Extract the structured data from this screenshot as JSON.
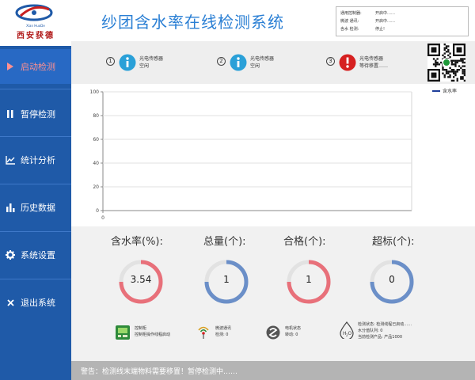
{
  "app": {
    "title": "纱团含水率在线检测系统",
    "logo_cn": "西安获德",
    "logo_en": "Xian HuoDe"
  },
  "status": {
    "rows": [
      {
        "key": "通用控制器:",
        "value": "开启中……"
      },
      {
        "key": "微波  通讯:",
        "value": "开启中……"
      },
      {
        "key": "含水  检测:",
        "value": "停止!"
      }
    ]
  },
  "sidebar": {
    "items": [
      {
        "label": "启动检测",
        "icon": "play-icon",
        "active": true
      },
      {
        "label": "暂停检测",
        "icon": "pause-icon",
        "active": false
      },
      {
        "label": "统计分析",
        "icon": "line-chart-icon",
        "active": false
      },
      {
        "label": "历史数据",
        "icon": "bar-chart-icon",
        "active": false
      },
      {
        "label": "系统设置",
        "icon": "gear-icon",
        "active": false
      },
      {
        "label": "退出系统",
        "icon": "close-icon",
        "active": false
      }
    ]
  },
  "sensors": [
    {
      "num": "1",
      "name": "光电传感器",
      "state": "空闲",
      "icon": "info-icon",
      "color": "#2aa0d8"
    },
    {
      "num": "2",
      "name": "光电传感器",
      "state": "空闲",
      "icon": "info-icon",
      "color": "#2aa0d8"
    },
    {
      "num": "3",
      "name": "光电传感器",
      "state": "等待移置……",
      "icon": "warning-icon",
      "color": "#d62020"
    }
  ],
  "chart_data": {
    "type": "line",
    "series": [
      {
        "name": "含水率",
        "values": []
      }
    ],
    "y_ticks": [
      "100",
      "80",
      "60",
      "40",
      "20",
      "0"
    ],
    "x_ticks": [
      "0"
    ],
    "ylim": [
      0,
      100
    ],
    "grid": true,
    "legend": "top-right"
  },
  "stats": [
    {
      "label": "含水率(%):",
      "value": "3.54",
      "color": "#e8707a"
    },
    {
      "label": "总量(个):",
      "value": "1",
      "color": "#6b8fc8"
    },
    {
      "label": "合格(个):",
      "value": "1",
      "color": "#e8707a"
    },
    {
      "label": "超标(个):",
      "value": "0",
      "color": "#6b8fc8"
    }
  ],
  "devices": [
    {
      "icon": "controller-icon",
      "line1": "控制柜",
      "line2": "控制柜操作线程启动"
    },
    {
      "icon": "antenna-icon",
      "line1": "微波通讯",
      "line2": "检测: 0"
    },
    {
      "icon": "motor-icon",
      "line1": "电机状态",
      "line2": "转动: 0"
    },
    {
      "icon": "water-drop-icon",
      "line1": "检测状态: 检测线程已启动……",
      "line2": "水分值队列: 0",
      "line3": "当前检测产品: 产品1000"
    }
  ],
  "footer": {
    "warning": "警告：检测线末端物料需要移置！暂停检测中……"
  },
  "colors": {
    "sidebar_bg": "#1f5aa8",
    "title": "#2a7fd4",
    "active_label": "#ff9090",
    "footer_bg": "#b4b4b4"
  }
}
